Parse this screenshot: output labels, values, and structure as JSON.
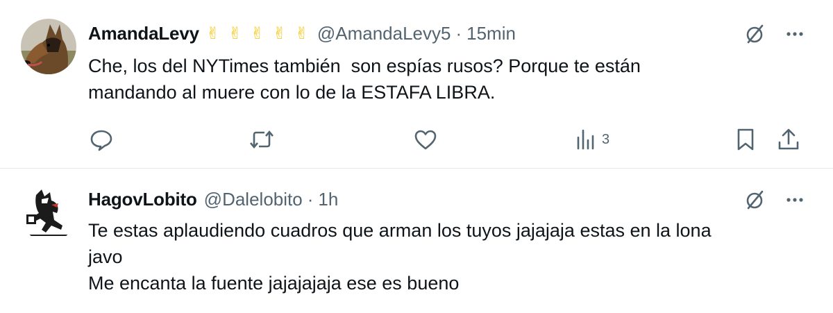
{
  "tweets": [
    {
      "name": "AmandaLevy",
      "badges": [
        "✌",
        "✌",
        "✌",
        "✌",
        "✌"
      ],
      "handle": "@AmandaLevy5",
      "time": "15min",
      "text_lines": [
        "Che, los del NYTimes también  son espías rusos? Porque te están",
        "mandando al muere con lo de la ESTAFA LIBRA."
      ],
      "views_count": "3",
      "icons": {
        "grok": "grok-slash-icon",
        "more": "more-dots-icon",
        "reply": "reply-bubble-icon",
        "retweet": "retweet-icon",
        "like": "heart-icon",
        "views": "analytics-bars-icon",
        "bookmark": "bookmark-icon",
        "share": "share-upload-icon"
      }
    },
    {
      "name": "HagovLobito",
      "handle": "@Dalelobito",
      "time": "1h",
      "text_lines": [
        "Te estas aplaudiendo cuadros que arman los tuyos jajajaja estas en la lona",
        "javo",
        "Me encanta la fuente jajajajaja ese es bueno"
      ],
      "icons": {
        "grok": "grok-slash-icon",
        "more": "more-dots-icon"
      }
    }
  ],
  "colors": {
    "text": "#0f1419",
    "secondary": "#536471",
    "divider": "#e6e9ea",
    "badge": "#f5c518"
  },
  "separator": "·"
}
